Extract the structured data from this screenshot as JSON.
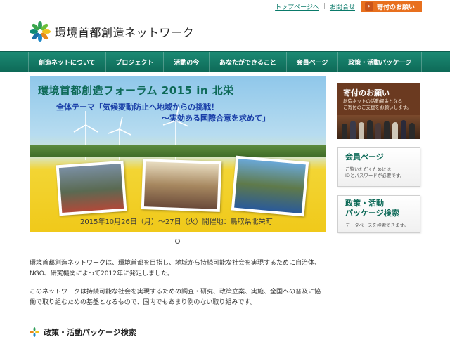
{
  "util": {
    "top_link": "トップページへ",
    "contact_link": "お問合せ",
    "donate_button": "寄付のお願い",
    "donate_arrow": "›"
  },
  "logo": {
    "name": "環境首都創造ネットワーク"
  },
  "nav": {
    "items": [
      "創造ネットについて",
      "プロジェクト",
      "活動の今",
      "あなたができること",
      "会員ページ",
      "政策・活動パッケージ"
    ]
  },
  "hero": {
    "title": "環境首都創造フォーラム 2015 in 北栄",
    "theme_line1": "全体テーマ「気候変動防止へ地域からの挑戦！",
    "theme_line2": "〜実効ある国際合意を求めて」",
    "date": "2015年10月26日（月）〜27日（火）開催地：鳥取県北栄町"
  },
  "intro": {
    "p1": "環境首都創造ネットワークは、環境首都を目指し、地域から持続可能な社会を実現するために自治体、NGO、研究機関によって2012年に発足しました。",
    "p2": "このネットワークは持続可能な社会を実現するための調査・研究、政策立案、実施、全国への普及に協働で取り組むための基盤となるもので、国内でもあまり例のない取り組みです。"
  },
  "section": {
    "title": "政策・活動パッケージ検索"
  },
  "sidebar": {
    "donate": {
      "title": "寄付のお願い",
      "desc": "創造ネットの活動資金となる\nご寄付のご支援をお願いします。"
    },
    "member": {
      "title": "会員ページ",
      "desc": "ご覧いただくためには\nIDとパスワードが必要です。"
    },
    "policy": {
      "title_line1": "政策・活動",
      "title_line2": "パッケージ検索",
      "desc": "データベースを検索できます。"
    }
  },
  "colors": {
    "nav": "#0e6a58",
    "donate": "#e8701e",
    "accent": "#0e6a58"
  }
}
